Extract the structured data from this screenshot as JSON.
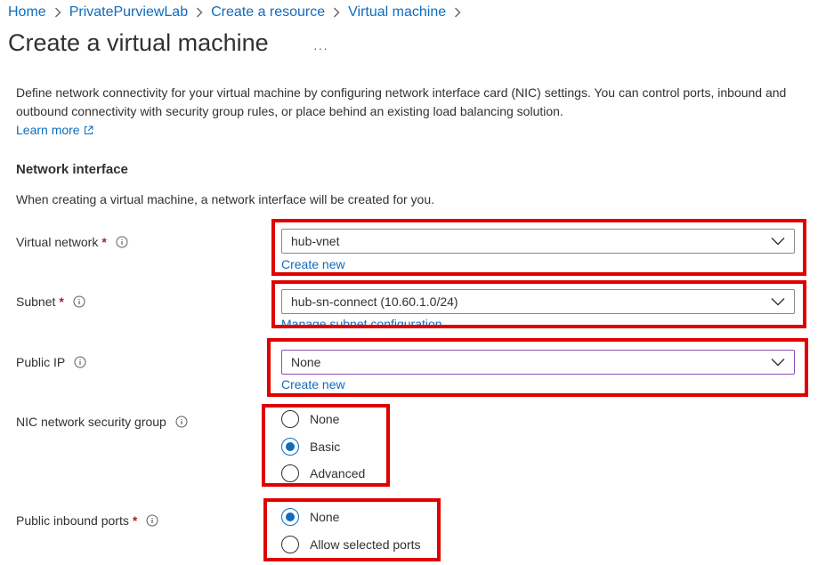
{
  "breadcrumb": [
    "Home",
    "PrivatePurviewLab",
    "Create a resource",
    "Virtual machine"
  ],
  "page": {
    "title": "Create a virtual machine",
    "more": "···"
  },
  "description": "Define network connectivity for your virtual machine by configuring network interface card (NIC) settings. You can control ports, inbound and outbound connectivity with security group rules, or place behind an existing load balancing solution.",
  "learn_more": "Learn more",
  "network_interface": {
    "heading": "Network interface",
    "note": "When creating a virtual machine, a network interface will be created for you."
  },
  "fields": {
    "virtual_network": {
      "label": "Virtual network",
      "value": "hub-vnet",
      "link": "Create new"
    },
    "subnet": {
      "label": "Subnet",
      "value": "hub-sn-connect (10.60.1.0/24)",
      "link": "Manage subnet configuration"
    },
    "public_ip": {
      "label": "Public IP",
      "value": "None",
      "link": "Create new"
    },
    "nic_nsg": {
      "label": "NIC network security group",
      "options": [
        "None",
        "Basic",
        "Advanced"
      ],
      "selected": "Basic"
    },
    "public_inbound_ports": {
      "label": "Public inbound ports",
      "options": [
        "None",
        "Allow selected ports"
      ],
      "selected": "None"
    }
  },
  "required_marker": "*",
  "icons": [
    "chevron-right-icon",
    "ellipsis-icon",
    "external-link-icon",
    "info-icon",
    "chevron-down-icon"
  ],
  "colors": {
    "link": "#0f6cbd",
    "highlight": "#e00000",
    "required": "#a4262c",
    "radio_selected": "#0f6cbd",
    "focus_border": "#8c4fb3"
  }
}
